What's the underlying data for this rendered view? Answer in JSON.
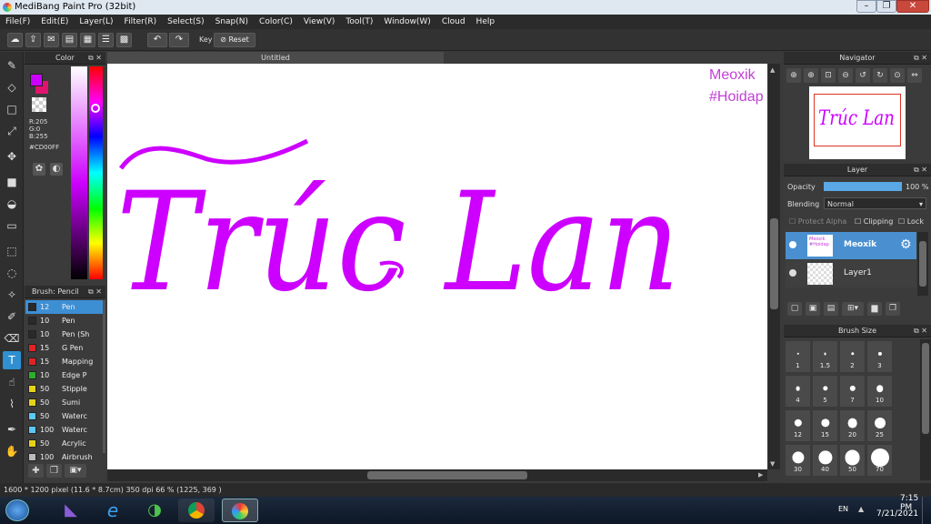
{
  "window": {
    "title": "MediBang Paint Pro (32bit)"
  },
  "menu": [
    "File(F)",
    "Edit(E)",
    "Layer(L)",
    "Filter(R)",
    "Select(S)",
    "Snap(N)",
    "Color(C)",
    "View(V)",
    "Tool(T)",
    "Window(W)",
    "Cloud",
    "Help"
  ],
  "toolbar": {
    "key_label": "Key",
    "reset_label": "Reset"
  },
  "color_panel": {
    "title": "Color",
    "r": "R:205",
    "g": "G:0",
    "b": "B:255",
    "hex": "#CD00FF",
    "fg_color": "#cd00ff",
    "bg_color": "#e0146e"
  },
  "brush_panel": {
    "title": "Brush: Pencil",
    "brushes": [
      {
        "size": "12",
        "name": "Pen",
        "color": "#2a2a2a",
        "selected": true
      },
      {
        "size": "10",
        "name": "Pen",
        "color": "#2a2a2a"
      },
      {
        "size": "10",
        "name": "Pen (Sh",
        "color": "#2a2a2a"
      },
      {
        "size": "15",
        "name": "G Pen",
        "color": "#e02424"
      },
      {
        "size": "15",
        "name": "Mapping",
        "color": "#e02424"
      },
      {
        "size": "10",
        "name": "Edge P",
        "color": "#2bb02b"
      },
      {
        "size": "50",
        "name": "Stipple",
        "color": "#e5d21a"
      },
      {
        "size": "50",
        "name": "Sumi",
        "color": "#e5d21a"
      },
      {
        "size": "50",
        "name": "Waterc",
        "color": "#5bc8f5"
      },
      {
        "size": "100",
        "name": "Waterc",
        "color": "#5bc8f5"
      },
      {
        "size": "50",
        "name": "Acrylic",
        "color": "#e5d21a"
      },
      {
        "size": "100",
        "name": "Airbrush",
        "color": "#bbbbbb"
      }
    ]
  },
  "canvas": {
    "tab_title": "Untitled",
    "artwork_text": "Trúc Lan",
    "corner_text_1": "Meoxik",
    "corner_text_2": "#Hoidap",
    "ink_color": "#cd00ff"
  },
  "navigator": {
    "title": "Navigator",
    "thumb_text": "Trúc Lan"
  },
  "layer_panel": {
    "title": "Layer",
    "opacity_label": "Opacity",
    "opacity_value": "100 %",
    "opacity_fraction": 1.0,
    "blending_label": "Blending",
    "blending_value": "Normal",
    "protect_alpha_label": "Protect Alpha",
    "clipping_label": "Clipping",
    "lock_label": "Lock",
    "layers": [
      {
        "name": "Meoxik",
        "thumb_lines": [
          "Meoxik",
          "#Hoidap"
        ],
        "selected": true
      },
      {
        "name": "Layer1",
        "thumb_lines": [],
        "selected": false
      }
    ]
  },
  "brush_size_panel": {
    "title": "Brush Size",
    "sizes": [
      "1",
      "1.5",
      "2",
      "3",
      "4",
      "5",
      "7",
      "10",
      "12",
      "15",
      "20",
      "25",
      "30",
      "40",
      "50",
      "70"
    ]
  },
  "status": {
    "dimensions": "1600 * 1200 pixel",
    "cm": "(11.6 * 8.7cm)",
    "dpi": "350 dpi",
    "zoom": "66 %",
    "coords": "(1225, 369 )"
  },
  "taskbar": {
    "lang": "EN",
    "time": "7:15 PM",
    "date": "7/21/2021"
  }
}
